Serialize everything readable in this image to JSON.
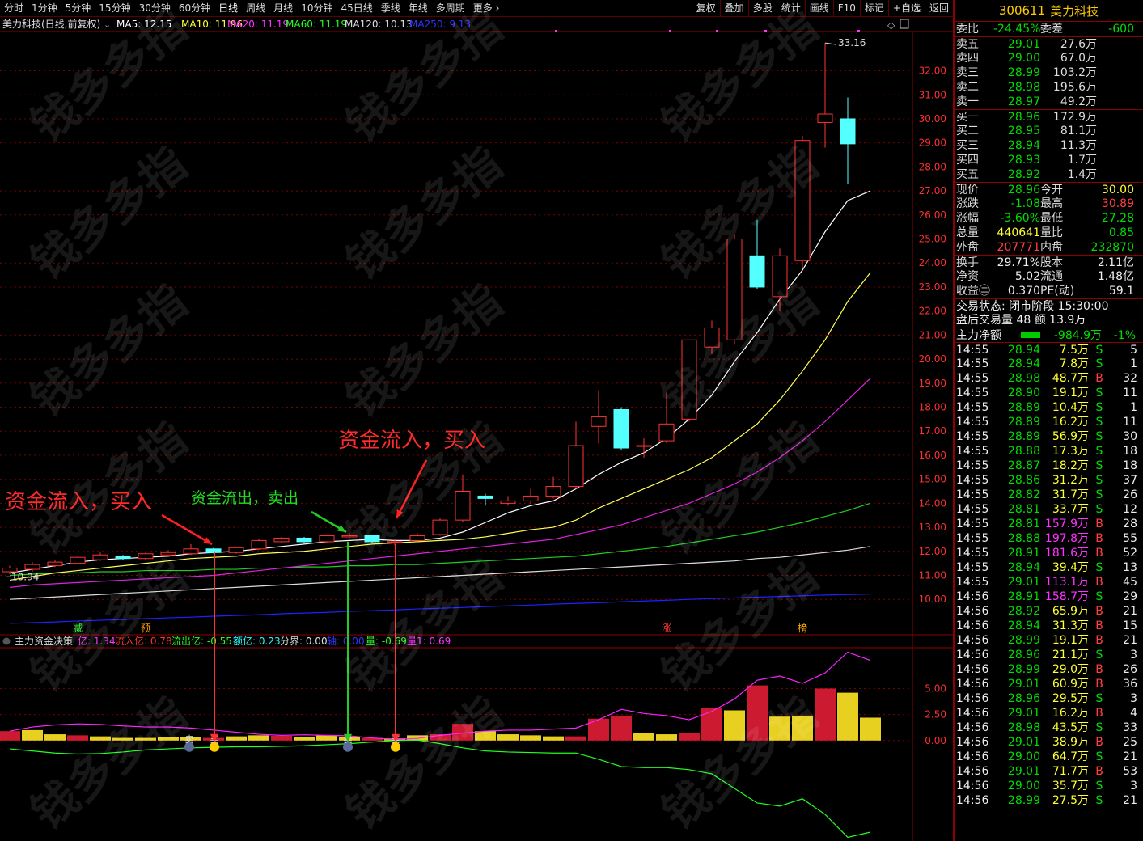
{
  "periods": [
    "分时",
    "1分钟",
    "5分钟",
    "15分钟",
    "30分钟",
    "60分钟",
    "日线",
    "周线",
    "月线",
    "10分钟",
    "45日线",
    "季线",
    "年线",
    "多周期",
    "更多"
  ],
  "tools": [
    "复权",
    "叠加",
    "多股",
    "统计",
    "画线",
    "F10",
    "标记",
    "+自选",
    "返回"
  ],
  "info": {
    "name": "美力科技(日线,前复权)",
    "ma5": "MA5: 12.15",
    "ma10": "MA10: 11.96",
    "ma20": "MA20: 11.19",
    "ma60": "MA60: 11.19",
    "ma120": "MA120: 10.13",
    "ma250": "MA250: 9.13"
  },
  "ind": {
    "name": "主力资金决策",
    "i1": "亿: 1.34",
    "i2": "流入亿: 0.78",
    "i3": "流出亿: -0.55",
    "i4": "额亿: 0.23",
    "i5": "分界: 0.00",
    "i6": "轴: 0.00",
    "i7": "量: -0.69",
    "i8": "量1: 0.69"
  },
  "annotations": {
    "buy": "资金流入，买入",
    "sell": "资金流出，卖出",
    "sellTag": "卖",
    "buyTag": "买"
  },
  "markers": {
    "jian": "减",
    "yu": "预",
    "zhang": "涨",
    "bang": "榜"
  },
  "priceHigh": "33.16",
  "priceLow": "10.94",
  "yTicks": [
    "32.00",
    "31.00",
    "30.00",
    "29.00",
    "28.00",
    "27.00",
    "26.00",
    "25.00",
    "24.00",
    "23.00",
    "22.00",
    "21.00",
    "20.00",
    "19.00",
    "18.00",
    "17.00",
    "16.00",
    "15.00",
    "14.00",
    "13.00",
    "12.00",
    "11.00",
    "10.00"
  ],
  "indTicks": [
    "5.00",
    "2.50",
    "0.00"
  ],
  "watermark": "钱多多指",
  "chart_data": {
    "type": "candlestick",
    "candles": [
      [
        11.15,
        11.3,
        11.05,
        11.4
      ],
      [
        11.25,
        11.45,
        11.15,
        11.55
      ],
      [
        11.4,
        11.55,
        11.35,
        11.65
      ],
      [
        11.5,
        11.75,
        11.45,
        11.8
      ],
      [
        11.65,
        11.85,
        11.6,
        11.95
      ],
      [
        11.8,
        11.7,
        11.65,
        11.85
      ],
      [
        11.7,
        11.9,
        11.65,
        11.95
      ],
      [
        11.85,
        11.95,
        11.8,
        12.05
      ],
      [
        11.9,
        12.1,
        11.85,
        12.3
      ],
      [
        12.1,
        11.95,
        11.9,
        12.15
      ],
      [
        11.95,
        12.15,
        11.9,
        12.2
      ],
      [
        12.1,
        12.45,
        12.05,
        12.5
      ],
      [
        12.4,
        12.55,
        12.35,
        12.6
      ],
      [
        12.55,
        12.4,
        12.35,
        12.6
      ],
      [
        12.4,
        12.65,
        12.35,
        12.7
      ],
      [
        12.6,
        12.65,
        12.55,
        12.75
      ],
      [
        12.65,
        12.4,
        12.35,
        12.7
      ],
      [
        12.4,
        12.4,
        12.25,
        12.5
      ],
      [
        12.45,
        12.65,
        12.4,
        12.75
      ],
      [
        12.7,
        13.3,
        12.65,
        13.4
      ],
      [
        13.3,
        14.5,
        13.2,
        15.2
      ],
      [
        14.3,
        14.2,
        13.9,
        14.4
      ],
      [
        14.0,
        14.1,
        13.9,
        14.3
      ],
      [
        14.1,
        14.3,
        14.0,
        14.6
      ],
      [
        14.3,
        14.7,
        14.2,
        15.1
      ],
      [
        14.7,
        16.4,
        14.6,
        17.4
      ],
      [
        17.2,
        17.6,
        16.5,
        18.7
      ],
      [
        17.9,
        16.3,
        16.2,
        18.0
      ],
      [
        16.4,
        16.4,
        15.9,
        16.7
      ],
      [
        16.6,
        17.3,
        16.5,
        18.6
      ],
      [
        17.5,
        20.8,
        17.4,
        20.8
      ],
      [
        20.5,
        21.3,
        20.2,
        21.6
      ],
      [
        20.8,
        25.0,
        20.6,
        25.2
      ],
      [
        24.3,
        23.0,
        22.9,
        25.8
      ],
      [
        22.6,
        24.3,
        22.0,
        24.6
      ],
      [
        24.1,
        29.1,
        23.8,
        29.3
      ],
      [
        29.85,
        30.2,
        28.8,
        33.16
      ],
      [
        30.0,
        28.96,
        27.28,
        30.89
      ]
    ],
    "ma5": [
      11.1,
      11.25,
      11.4,
      11.55,
      11.65,
      11.7,
      11.75,
      11.8,
      11.9,
      11.95,
      12.0,
      12.1,
      12.2,
      12.3,
      12.4,
      12.45,
      12.5,
      12.45,
      12.45,
      12.55,
      12.8,
      13.2,
      13.6,
      13.9,
      14.1,
      14.6,
      15.2,
      15.7,
      16.1,
      16.7,
      17.5,
      18.5,
      19.9,
      21.1,
      22.5,
      23.7,
      25.3,
      26.6,
      27.0
    ],
    "ma10": [
      10.8,
      10.95,
      11.1,
      11.2,
      11.3,
      11.4,
      11.5,
      11.6,
      11.7,
      11.75,
      11.8,
      11.9,
      11.95,
      12.0,
      12.1,
      12.2,
      12.3,
      12.35,
      12.4,
      12.45,
      12.5,
      12.6,
      12.75,
      12.9,
      13.0,
      13.3,
      13.8,
      14.2,
      14.6,
      15.0,
      15.4,
      15.9,
      16.6,
      17.3,
      18.3,
      19.5,
      20.8,
      22.4,
      23.6
    ],
    "ma20": [
      10.5,
      10.6,
      10.65,
      10.7,
      10.75,
      10.8,
      10.85,
      10.9,
      10.95,
      11.0,
      11.1,
      11.2,
      11.3,
      11.4,
      11.5,
      11.6,
      11.7,
      11.8,
      11.9,
      12.0,
      12.1,
      12.2,
      12.3,
      12.4,
      12.5,
      12.7,
      12.9,
      13.1,
      13.4,
      13.7,
      14.0,
      14.4,
      14.8,
      15.3,
      15.9,
      16.6,
      17.4,
      18.3,
      19.2
    ],
    "ma60": [
      11.0,
      11.05,
      11.1,
      11.1,
      11.15,
      11.15,
      11.2,
      11.2,
      11.2,
      11.25,
      11.25,
      11.3,
      11.3,
      11.35,
      11.35,
      11.4,
      11.4,
      11.45,
      11.45,
      11.5,
      11.55,
      11.6,
      11.65,
      11.7,
      11.75,
      11.8,
      11.9,
      12.0,
      12.1,
      12.2,
      12.35,
      12.5,
      12.65,
      12.8,
      13.0,
      13.2,
      13.45,
      13.7,
      14.0
    ],
    "ma120": [
      10.0,
      10.05,
      10.1,
      10.15,
      10.2,
      10.25,
      10.3,
      10.35,
      10.4,
      10.45,
      10.5,
      10.55,
      10.6,
      10.65,
      10.7,
      10.75,
      10.8,
      10.85,
      10.9,
      10.95,
      11.0,
      11.05,
      11.1,
      11.15,
      11.2,
      11.25,
      11.3,
      11.35,
      11.4,
      11.45,
      11.5,
      11.55,
      11.6,
      11.7,
      11.75,
      11.85,
      11.95,
      12.05,
      12.2
    ],
    "ma250": [
      9.0,
      9.03,
      9.06,
      9.1,
      9.13,
      9.16,
      9.2,
      9.23,
      9.26,
      9.3,
      9.33,
      9.36,
      9.4,
      9.43,
      9.46,
      9.5,
      9.53,
      9.56,
      9.6,
      9.63,
      9.66,
      9.7,
      9.73,
      9.76,
      9.8,
      9.83,
      9.86,
      9.9,
      9.93,
      9.96,
      10.0,
      10.03,
      10.06,
      10.09,
      10.12,
      10.15,
      10.18,
      10.2,
      10.22
    ],
    "indBars": [
      0.9,
      1.0,
      0.6,
      0.5,
      0.4,
      0.25,
      0.25,
      0.3,
      0.35,
      0.25,
      0.4,
      0.5,
      0.45,
      0.3,
      0.5,
      0.35,
      0.25,
      0.2,
      0.5,
      0.6,
      1.6,
      0.9,
      0.6,
      0.5,
      0.4,
      0.4,
      2.1,
      2.4,
      0.7,
      0.6,
      0.7,
      3.1,
      2.9,
      5.3,
      2.3,
      2.4,
      5.0,
      4.6,
      2.2
    ],
    "indPos": [
      0.9,
      1.3,
      1.5,
      1.6,
      1.55,
      1.4,
      1.3,
      1.3,
      1.2,
      1.0,
      0.8,
      0.6,
      0.5,
      0.55,
      0.5,
      0.45,
      0.25,
      0.1,
      0.2,
      0.5,
      0.7,
      0.9,
      1.0,
      1.0,
      1.1,
      1.2,
      2.0,
      3.0,
      2.6,
      2.4,
      2.0,
      2.8,
      4.0,
      5.8,
      6.2,
      5.5,
      6.5,
      8.5,
      7.7
    ],
    "indNeg": [
      -0.8,
      -1.0,
      -1.2,
      -1.3,
      -1.25,
      -1.1,
      -0.9,
      -0.8,
      -0.7,
      -0.65,
      -0.6,
      -0.6,
      -0.55,
      -0.5,
      -0.4,
      -0.3,
      -0.15,
      0.0,
      0.05,
      -0.3,
      -0.7,
      -1.0,
      -1.1,
      -1.15,
      -1.2,
      -1.2,
      -1.8,
      -2.5,
      -2.6,
      -2.6,
      -2.8,
      -3.2,
      -4.6,
      -6.0,
      -6.3,
      -5.6,
      -7.1,
      -9.3,
      -8.8
    ],
    "sellIdx": [
      8,
      15
    ],
    "buyIdx": [
      9,
      17
    ],
    "ylim": [
      9.3,
      33.6
    ],
    "indYlim": [
      -9.5,
      9.0
    ]
  },
  "quote": {
    "code": "300611",
    "name": "美力科技",
    "rows1": [
      {
        "a": "委比",
        "b": "-24.45%",
        "bc": "grn",
        "c": "委差",
        "d": "-600",
        "dc": "grn"
      }
    ],
    "asks": [
      {
        "l": "卖五",
        "p": "29.01",
        "v": "27.6万"
      },
      {
        "l": "卖四",
        "p": "29.00",
        "v": "67.0万"
      },
      {
        "l": "卖三",
        "p": "28.99",
        "v": "103.2万"
      },
      {
        "l": "卖二",
        "p": "28.98",
        "v": "195.6万"
      },
      {
        "l": "卖一",
        "p": "28.97",
        "v": "49.2万"
      }
    ],
    "bids": [
      {
        "l": "买一",
        "p": "28.96",
        "v": "172.9万"
      },
      {
        "l": "买二",
        "p": "28.95",
        "v": "81.1万"
      },
      {
        "l": "买三",
        "p": "28.94",
        "v": "11.3万"
      },
      {
        "l": "买四",
        "p": "28.93",
        "v": "1.7万"
      },
      {
        "l": "买五",
        "p": "28.92",
        "v": "1.4万"
      }
    ],
    "stats": [
      {
        "a": "现价",
        "b": "28.96",
        "bc": "grn",
        "c": "今开",
        "d": "30.00",
        "dc": "yel"
      },
      {
        "a": "涨跌",
        "b": "-1.08",
        "bc": "grn",
        "c": "最高",
        "d": "30.89",
        "dc": "red"
      },
      {
        "a": "涨幅",
        "b": "-3.60%",
        "bc": "grn",
        "c": "最低",
        "d": "27.28",
        "dc": "grn"
      },
      {
        "a": "总量",
        "b": "440641",
        "bc": "yel",
        "c": "量比",
        "d": "0.85",
        "dc": "grn"
      },
      {
        "a": "外盘",
        "b": "207771",
        "bc": "red",
        "c": "内盘",
        "d": "232870",
        "dc": "grn"
      }
    ],
    "stats2": [
      {
        "a": "换手",
        "b": "29.71%",
        "c": "股本",
        "d": "2.11亿"
      },
      {
        "a": "净资",
        "b": "5.02",
        "c": "流通",
        "d": "1.48亿"
      },
      {
        "a": "收益㊁",
        "b": "0.370",
        "c": "PE(动)",
        "d": "59.1"
      }
    ],
    "status": "交易状态: 闭市阶段 15:30:00",
    "after": "盘后交易量 48 额 13.9万",
    "flowLabel": "主力净额",
    "flowVal": "-984.9万",
    "flowPct": "-1%",
    "ticks": [
      [
        "14:55",
        "28.94",
        "7.5万",
        "S",
        "5"
      ],
      [
        "14:55",
        "28.94",
        "7.8万",
        "S",
        "1"
      ],
      [
        "14:55",
        "28.98",
        "48.7万",
        "B",
        "32"
      ],
      [
        "14:55",
        "28.90",
        "19.1万",
        "S",
        "11"
      ],
      [
        "14:55",
        "28.89",
        "10.4万",
        "S",
        "1"
      ],
      [
        "14:55",
        "28.89",
        "16.2万",
        "S",
        "11"
      ],
      [
        "14:55",
        "28.89",
        "56.9万",
        "S",
        "30"
      ],
      [
        "14:55",
        "28.88",
        "17.3万",
        "S",
        "18"
      ],
      [
        "14:55",
        "28.87",
        "18.2万",
        "S",
        "18"
      ],
      [
        "14:55",
        "28.86",
        "31.2万",
        "S",
        "37"
      ],
      [
        "14:55",
        "28.82",
        "31.7万",
        "S",
        "26"
      ],
      [
        "14:55",
        "28.81",
        "33.7万",
        "S",
        "12"
      ],
      [
        "14:55",
        "28.81",
        "157.9万",
        "B",
        "28"
      ],
      [
        "14:55",
        "28.88",
        "197.8万",
        "B",
        "55"
      ],
      [
        "14:55",
        "28.91",
        "181.6万",
        "B",
        "52"
      ],
      [
        "14:55",
        "28.94",
        "39.4万",
        "S",
        "13"
      ],
      [
        "14:55",
        "29.01",
        "113.1万",
        "B",
        "45"
      ],
      [
        "14:56",
        "28.91",
        "158.7万",
        "S",
        "29"
      ],
      [
        "14:56",
        "28.92",
        "65.9万",
        "B",
        "21"
      ],
      [
        "14:56",
        "28.94",
        "31.3万",
        "B",
        "15"
      ],
      [
        "14:56",
        "28.99",
        "19.1万",
        "B",
        "21"
      ],
      [
        "14:56",
        "28.96",
        "21.1万",
        "S",
        "3"
      ],
      [
        "14:56",
        "28.99",
        "29.0万",
        "B",
        "26"
      ],
      [
        "14:56",
        "29.01",
        "60.9万",
        "B",
        "36"
      ],
      [
        "14:56",
        "28.96",
        "29.5万",
        "S",
        "3"
      ],
      [
        "14:56",
        "29.01",
        "16.2万",
        "B",
        "4"
      ],
      [
        "14:56",
        "28.98",
        "43.5万",
        "S",
        "33"
      ],
      [
        "14:56",
        "29.01",
        "38.9万",
        "B",
        "25"
      ],
      [
        "14:56",
        "29.00",
        "64.7万",
        "S",
        "21"
      ],
      [
        "14:56",
        "29.01",
        "71.7万",
        "B",
        "53"
      ],
      [
        "14:56",
        "29.00",
        "35.7万",
        "S",
        "3"
      ],
      [
        "14:56",
        "28.99",
        "27.5万",
        "S",
        "21"
      ]
    ]
  }
}
